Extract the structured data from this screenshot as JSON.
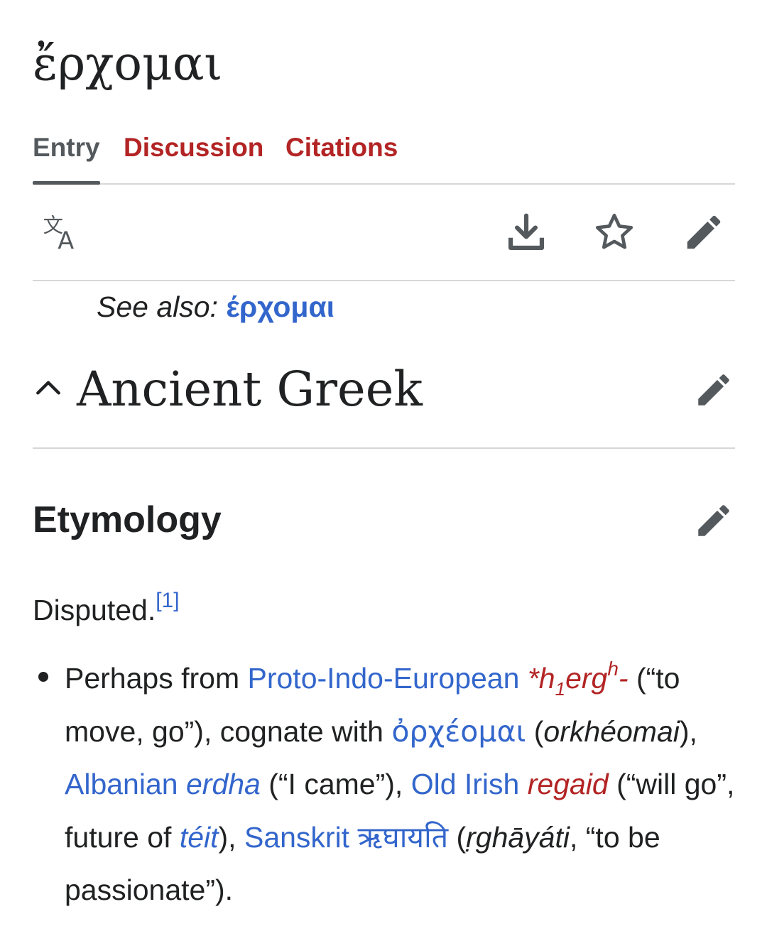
{
  "page_title": "ἔρχομαι",
  "tabs": [
    {
      "label": "Entry",
      "active": true
    },
    {
      "label": "Discussion",
      "active": false
    },
    {
      "label": "Citations",
      "active": false
    }
  ],
  "toolbar": {
    "language_icon": "translate-icon",
    "download_icon": "download-icon",
    "watch_icon": "star-icon",
    "edit_icon": "pencil-icon"
  },
  "see_also": {
    "prefix": "See also: ",
    "link": "έρχομαι"
  },
  "language_section": {
    "title": "Ancient Greek",
    "collapse_icon": "chevron-up-icon",
    "edit_icon": "pencil-icon"
  },
  "etymology": {
    "heading": "Etymology",
    "edit_icon": "pencil-icon",
    "disputed": "Disputed.",
    "ref": "[1]",
    "bullet": {
      "t1": "Perhaps from ",
      "pie_link": "Proto-Indo-European",
      "pie_root_a": "*h",
      "pie_root_sub": "1",
      "pie_root_b": "erg",
      "pie_root_sup": "h",
      "pie_root_c": "-",
      "t2": " (“to move, go”), cognate with ",
      "greek_link": "ὀρχέομαι",
      "t3": " (",
      "greek_translit": "orkhéomai",
      "t4": "), ",
      "alb_link": "Albanian",
      "t5": " ",
      "alb_word": "erdha",
      "t6": " (“I came”), ",
      "oir_link": "Old Irish",
      "t7": " ",
      "oir_word": "regaid",
      "t8": " (“will go”, future of ",
      "oir_word2": "téit",
      "t9": "), ",
      "skt_link": "Sanskrit",
      "t10": " ",
      "skt_word": "ऋघायति",
      "t11": " (",
      "skt_translit": "ṛghāyáti",
      "t12": ", “to be passionate”)."
    }
  },
  "colors": {
    "link_blue": "#3366cc",
    "link_red": "#b32424",
    "text": "#202122",
    "icon_gray": "#54595d",
    "divider": "#d6d7d9"
  }
}
